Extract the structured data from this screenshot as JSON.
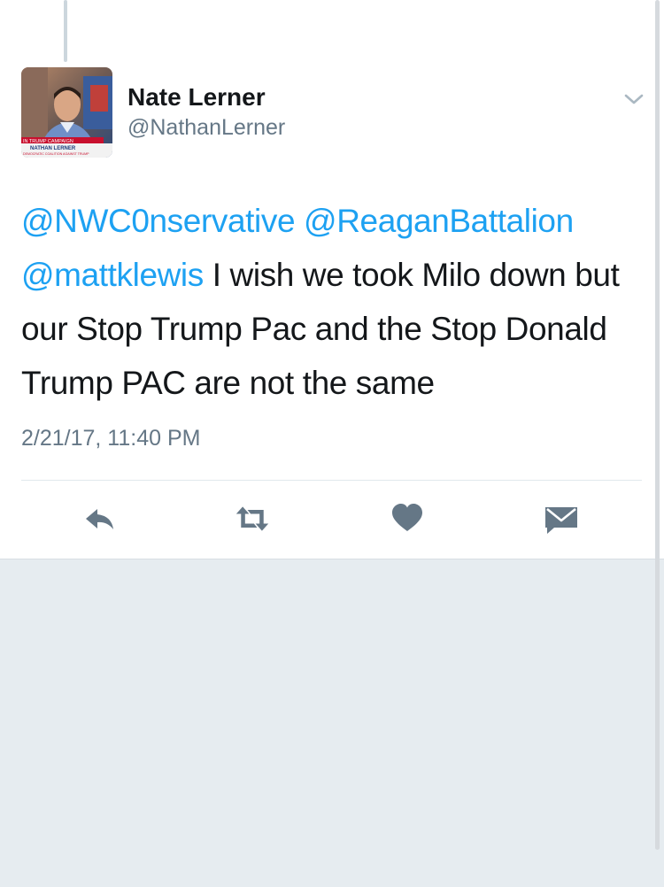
{
  "tweet": {
    "author_name": "Nate Lerner",
    "author_handle": "@NathanLerner",
    "avatar": {
      "chyron_top": "IN TRUMP CAMPAIGN",
      "chyron_name": "NATHAN LERNER",
      "chyron_sub": "DEMOCRATIC COALITION AGAINST TRUMP"
    },
    "text_segments": [
      {
        "text": "@NWC0nservative",
        "type": "mention"
      },
      {
        "text": " ",
        "type": "text"
      },
      {
        "text": "@ReaganBattalion",
        "type": "mention"
      },
      {
        "text": " ",
        "type": "text"
      },
      {
        "text": "@mattklewis",
        "type": "mention"
      },
      {
        "text": " I wish we took Milo down but our Stop Trump Pac and the Stop Donald Trump PAC are not the same",
        "type": "text"
      }
    ],
    "timestamp": "2/21/17, 11:40 PM"
  },
  "actions": [
    {
      "name": "reply-icon"
    },
    {
      "name": "retweet-icon"
    },
    {
      "name": "like-icon"
    },
    {
      "name": "direct-message-icon"
    }
  ],
  "colors": {
    "mention": "#1da1f2",
    "icon": "#657786",
    "text": "#14171a",
    "background": "#e6ecf0"
  }
}
